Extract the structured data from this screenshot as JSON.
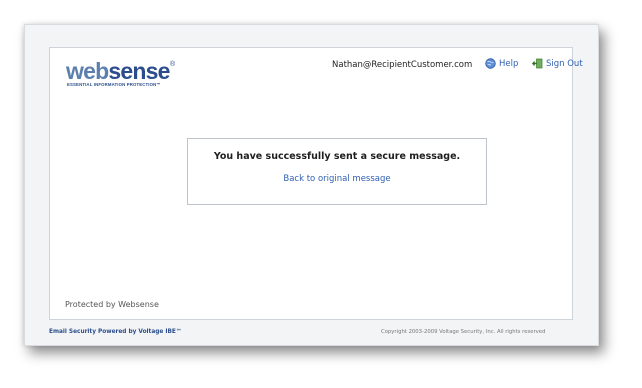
{
  "logo": {
    "word_web": "web",
    "word_sense": "sense",
    "registered": "®",
    "tagline": "ESSENTIAL INFORMATION PROTECTION™"
  },
  "header": {
    "user_email": "Nathan@RecipientCustomer.com",
    "help_label": "Help",
    "signout_label": "Sign Out"
  },
  "message": {
    "text": "You have successfully sent a secure message.",
    "back_link": "Back to original message"
  },
  "panel_footer": {
    "protected_text": "Protected by Websense"
  },
  "footer": {
    "powered_by": "Email Security Powered by Voltage IBE™",
    "copyright": "Copyright 2003-2009 Voltage Security, Inc. All rights reserved"
  },
  "icons": {
    "help": "help-globe-icon",
    "signout": "exit-door-icon"
  },
  "colors": {
    "brand_light": "#5d7fae",
    "brand_dark": "#2c4d8c",
    "link": "#2f5fb3"
  }
}
